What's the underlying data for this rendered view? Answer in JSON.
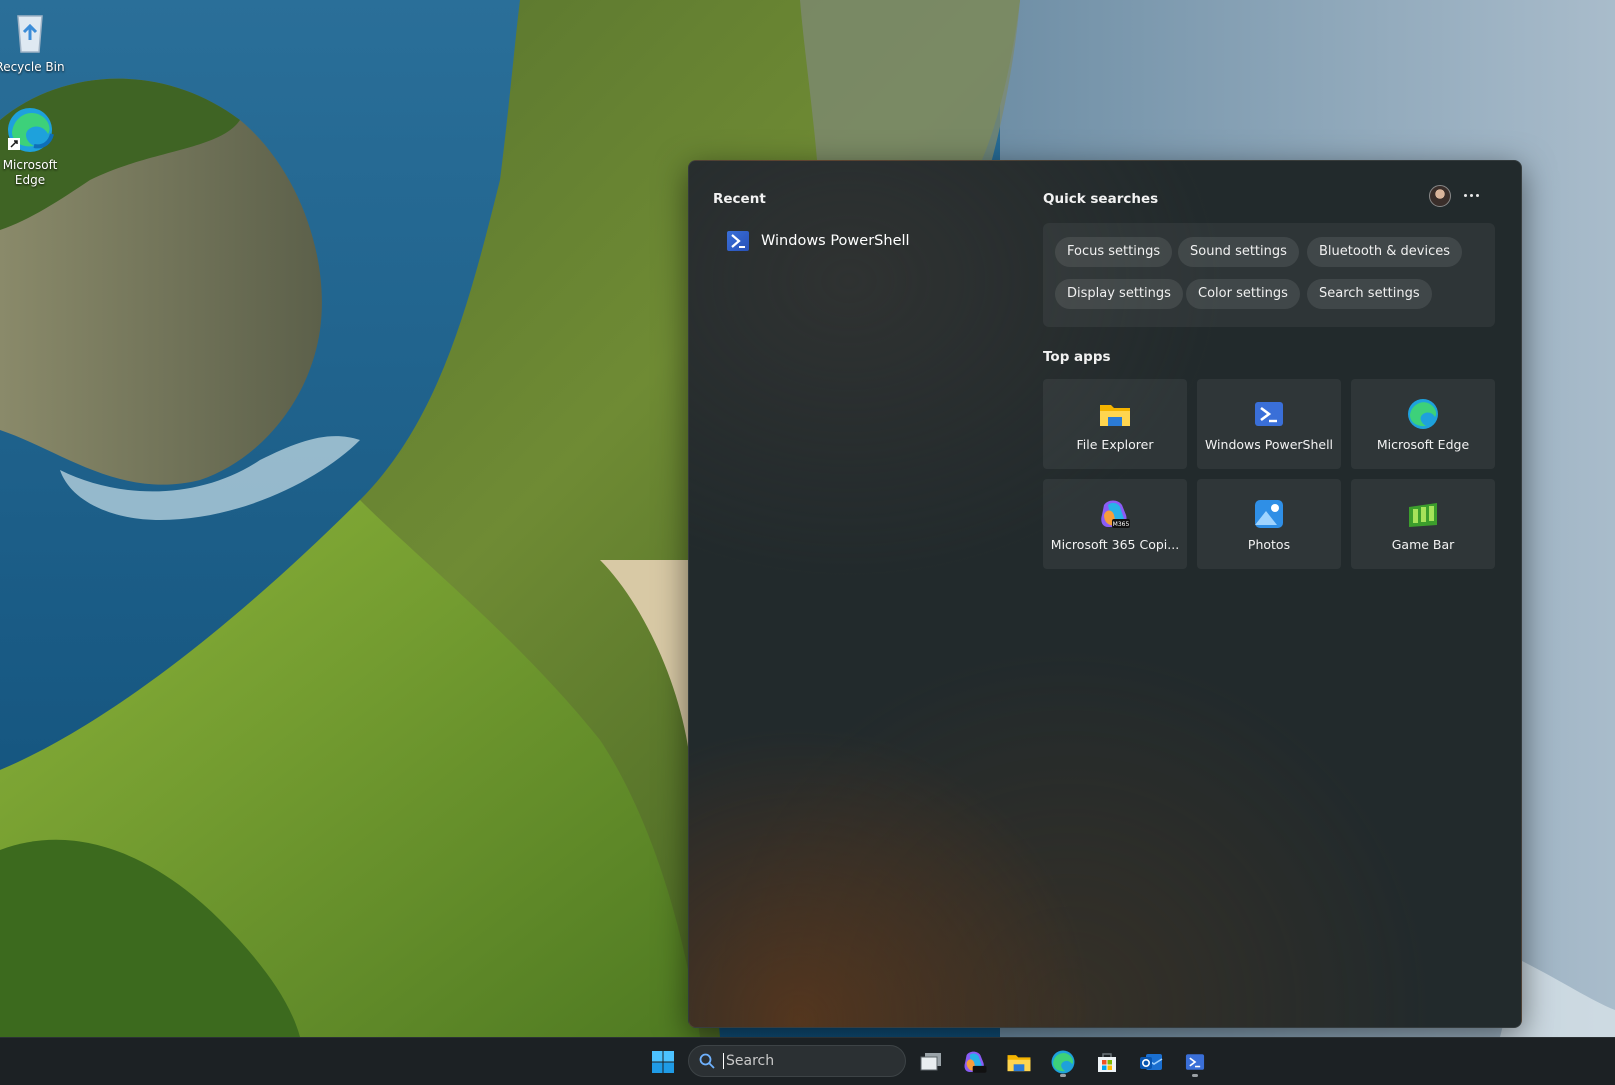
{
  "desktop": {
    "icons": [
      {
        "label": "Recycle Bin",
        "icon": "recycle-bin-icon"
      },
      {
        "label": "Microsoft Edge",
        "icon": "edge-icon"
      }
    ]
  },
  "flyout": {
    "recent": {
      "title": "Recent",
      "items": [
        {
          "label": "Windows PowerShell",
          "icon": "powershell-icon"
        }
      ]
    },
    "quick_searches": {
      "title": "Quick searches",
      "chips": [
        "Focus settings",
        "Sound settings",
        "Bluetooth & devices",
        "Display settings",
        "Color settings",
        "Search settings"
      ]
    },
    "top_apps": {
      "title": "Top apps",
      "apps": [
        {
          "label": "File Explorer",
          "icon": "file-explorer-icon"
        },
        {
          "label": "Windows PowerShell",
          "icon": "powershell-icon"
        },
        {
          "label": "Microsoft Edge",
          "icon": "edge-icon"
        },
        {
          "label": "Microsoft 365 Copi...",
          "icon": "m365-copilot-icon"
        },
        {
          "label": "Photos",
          "icon": "photos-icon"
        },
        {
          "label": "Game Bar",
          "icon": "game-bar-icon"
        }
      ]
    }
  },
  "taskbar": {
    "search_placeholder": "Search",
    "pinned": [
      "start-icon",
      "task-view-icon",
      "m365-copilot-icon",
      "file-explorer-icon",
      "edge-icon",
      "microsoft-store-icon",
      "outlook-icon",
      "powershell-icon"
    ]
  },
  "colors": {
    "accent": "#3a6fd8",
    "flyout_bg": "#222a2c",
    "taskbar_bg": "#1c2124"
  }
}
